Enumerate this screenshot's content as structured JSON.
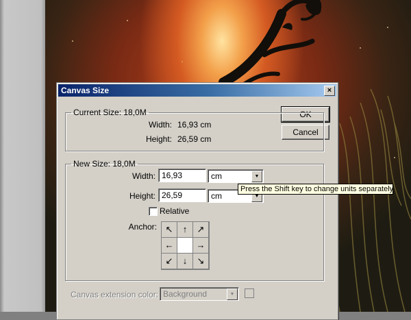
{
  "dialog": {
    "title": "Canvas Size",
    "close_label": "×",
    "ok_label": "OK",
    "cancel_label": "Cancel"
  },
  "current_size": {
    "legend": "Current Size: 18,0M",
    "width_label": "Width:",
    "width_value": "16,93 cm",
    "height_label": "Height:",
    "height_value": "26,59 cm"
  },
  "new_size": {
    "legend": "New Size: 18,0M",
    "width_label": "Width:",
    "width_value": "16,93",
    "width_unit": "cm",
    "height_label": "Height:",
    "height_value": "26,59",
    "height_unit": "cm",
    "relative_label": "Relative",
    "relative_checked": false,
    "anchor_label": "Anchor:",
    "anchor_arrows": [
      "↖",
      "↑",
      "↗",
      "←",
      "",
      "→",
      "↙",
      "↓",
      "↘"
    ]
  },
  "extension": {
    "label": "Canvas extension color:",
    "value": "Background"
  },
  "tooltip": {
    "text": "Press the Shift key to change units separately"
  },
  "icons": {
    "dropdown": "▼"
  }
}
